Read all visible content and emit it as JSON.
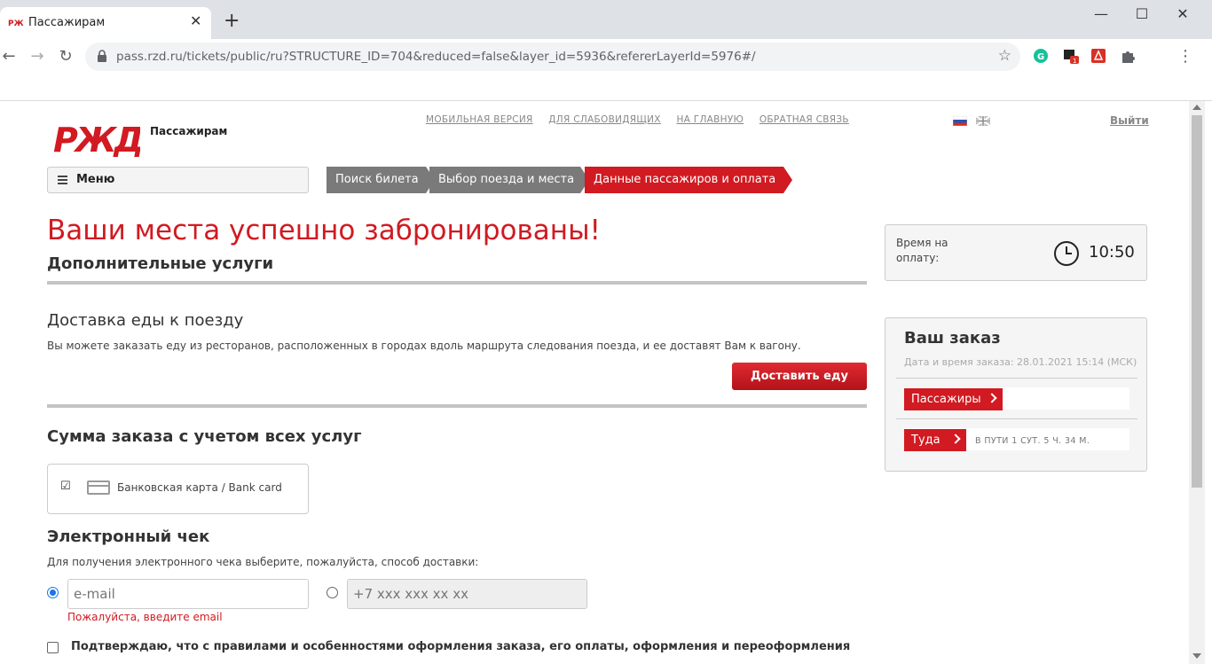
{
  "browser": {
    "tab_title": "Пассажирам",
    "url": "pass.rzd.ru/tickets/public/ru?STRUCTURE_ID=704&reduced=false&layer_id=5936&refererLayerId=5976#/",
    "icons": [
      "back-icon",
      "forward-icon",
      "reload-icon",
      "lock-icon",
      "star-icon",
      "grammarly-icon",
      "extension-icon",
      "pdf-icon",
      "puzzle-icon",
      "kebab-menu-icon"
    ],
    "ext_badge": "1"
  },
  "header": {
    "logo_text": "РЖД",
    "caption": "Пассажирам",
    "links": [
      "МОБИЛЬНАЯ ВЕРСИЯ",
      "ДЛЯ СЛАБОВИДЯЩИХ",
      "НА ГЛАВНУЮ",
      "ОБРАТНАЯ СВЯЗЬ"
    ],
    "logout": "Выйти"
  },
  "menu": {
    "label": "Меню"
  },
  "steps": [
    "Поиск билета",
    "Выбор поезда и места",
    "Данные пассажиров и оплата"
  ],
  "main": {
    "success_title": "Ваши места успешно забронированы!",
    "extra_services": "Дополнительные услуги",
    "food_title": "Доставка еды к поезду",
    "food_desc": "Вы можете заказать еду из ресторанов, расположенных в городах вдоль маршрута следования поезда, и ее доставят Вам к вагону.",
    "food_button": "Доставить еду",
    "sum_title": "Сумма заказа с учетом всех услуг",
    "payment_method": "Банковская карта / Bank card",
    "receipt_title": "Электронный чек",
    "receipt_desc": "Для получения электронного чека выберите, пожалуйста, способ доставки:",
    "email_placeholder": "e-mail",
    "phone_placeholder": "+7 xxx xxx xx xx",
    "email_error": "Пожалуйста, введите email",
    "confirm_text": "Подтверждаю, что с правилами и особенностями оформления заказа, его оплаты, оформления и переоформления"
  },
  "timer": {
    "label": "Время на оплату:",
    "value": "10:50"
  },
  "order": {
    "title": "Ваш заказ",
    "date": "Дата и время заказа: 28.01.2021 15:14 (МСК)",
    "passengers": "Пассажиры",
    "direction": "Туда",
    "route_info": "В ПУТИ 1 СУТ. 5 Ч. 34 М."
  },
  "colors": {
    "brand_red": "#d11a21",
    "step_gray": "#7a7a7a"
  }
}
